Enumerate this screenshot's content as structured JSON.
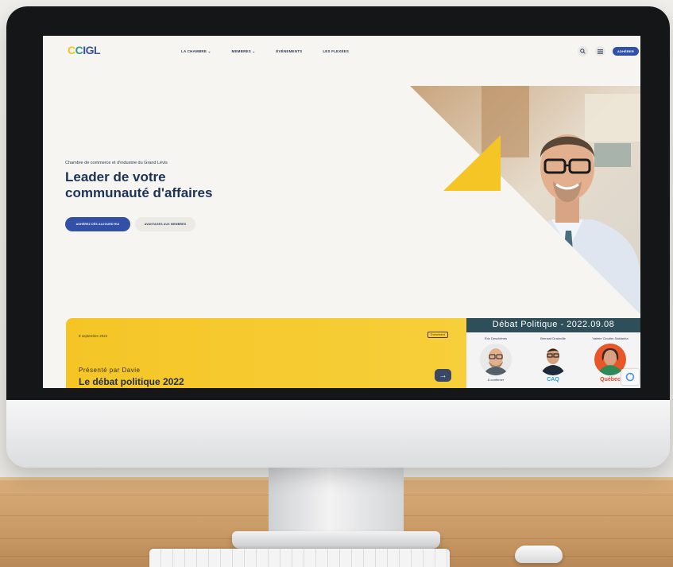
{
  "site": {
    "logo": {
      "p1": "C",
      "p2": "C",
      "p3": "IGL"
    },
    "nav": {
      "items": [
        "LA CHAMBRE ⌄",
        "MEMBRES ⌄",
        "ÉVÉNEMENTS",
        "LES FLEXÉES"
      ],
      "search_icon": "search-icon",
      "menu_icon": "hamburger-icon",
      "cta": "ADHÉRER"
    },
    "hero": {
      "eyebrow": "Chambre de commerce et d'industrie du Grand Lévis",
      "headline_line1": "Leader de votre",
      "headline_line2": "communauté d'affaires",
      "primary_button": "ADHÉREZ DÈS AUJOURD'HUI",
      "secondary_button": "AVANTAGES AUX MEMBRES"
    },
    "event": {
      "date": "8 septembre 2022",
      "tag": "Événement",
      "presenter": "Présenté par Davie",
      "title": "Le débat politique 2022",
      "arrow": "→"
    },
    "debate": {
      "title": "Débat Politique - 2022.09.08",
      "candidates": [
        {
          "name": "Éric Deschênes",
          "caption": "À confirmer",
          "logo": ""
        },
        {
          "name": "Bernard Drainville",
          "caption": "",
          "logo": "CAQ"
        },
        {
          "name": "Valérie Cloutier-Saldanha",
          "caption": "",
          "logo": "Québec"
        }
      ]
    }
  },
  "colors": {
    "brand_blue": "#3250a6",
    "brand_yellow": "#f5c526",
    "headline": "#1c3358",
    "debate_band": "#2e4f5a"
  }
}
